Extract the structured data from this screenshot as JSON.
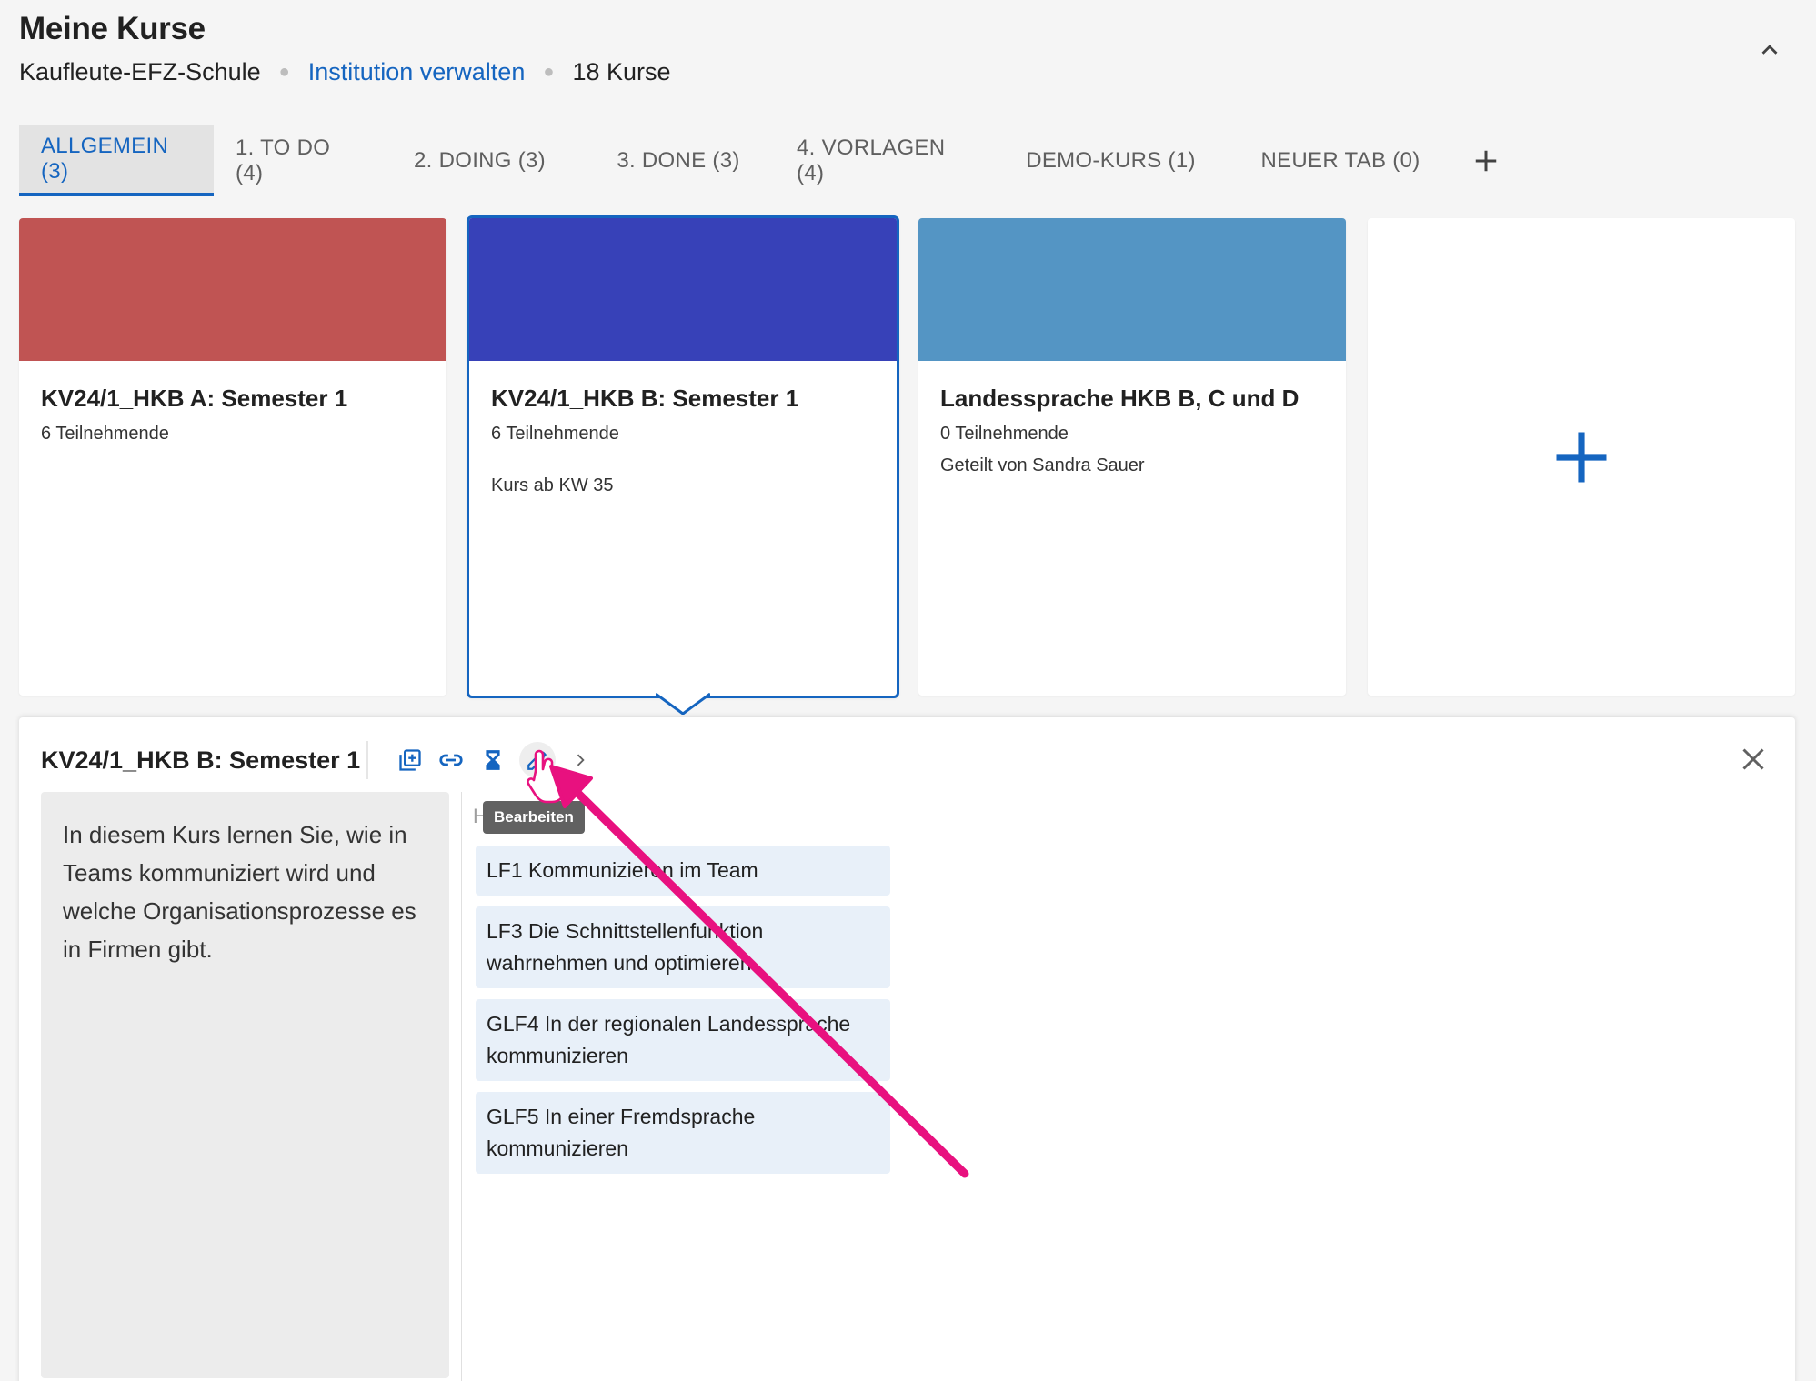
{
  "header": {
    "title": "Meine Kurse",
    "institution": "Kaufleute-EFZ-Schule",
    "manage_link": "Institution verwalten",
    "course_count": "18 Kurse"
  },
  "tabs": [
    {
      "label": "ALLGEMEIN (3)",
      "active": true
    },
    {
      "label": "1. TO DO (4)"
    },
    {
      "label": "2. DOING (3)"
    },
    {
      "label": "3. DONE (3)"
    },
    {
      "label": "4. VORLAGEN (4)"
    },
    {
      "label": "DEMO-KURS (1)"
    },
    {
      "label": "NEUER TAB (0)"
    }
  ],
  "cards": [
    {
      "title": "KV24/1_HKB A: Semester 1",
      "participants": "6 Teilnehmende",
      "color": "#c05453"
    },
    {
      "title": "KV24/1_HKB B: Semester 1",
      "participants": "6 Teilnehmende",
      "note": "Kurs ab KW 35",
      "color": "#3741b8"
    },
    {
      "title": "Landessprache HKB B, C und D",
      "participants": "0 Teilnehmende",
      "shared": "Geteilt von Sandra Sauer",
      "color": "#5495c4"
    }
  ],
  "detail": {
    "title": "KV24/1_HKB B: Semester 1",
    "tooltip": "Bearbeiten",
    "truncated_label": "H",
    "description": "In diesem Kurs lernen Sie, wie in Teams kommuniziert wird und welche Organisationsprozesse es in Firmen gibt.",
    "learning_fields": [
      "LF1 Kommunizieren im Team",
      "LF3 Die Schnittstellenfunktion wahrnehmen und optimieren",
      "GLF4 In der regionalen Landessprache kommunizieren",
      "GLF5 In einer Fremdsprache kommunizieren"
    ],
    "toolbar_icons": [
      "duplicate-icon",
      "link-icon",
      "hourglass-icon",
      "edit-icon",
      "chevron-right-icon"
    ]
  },
  "colors": {
    "accent": "#1565c0",
    "annotation": "#e8117f"
  }
}
